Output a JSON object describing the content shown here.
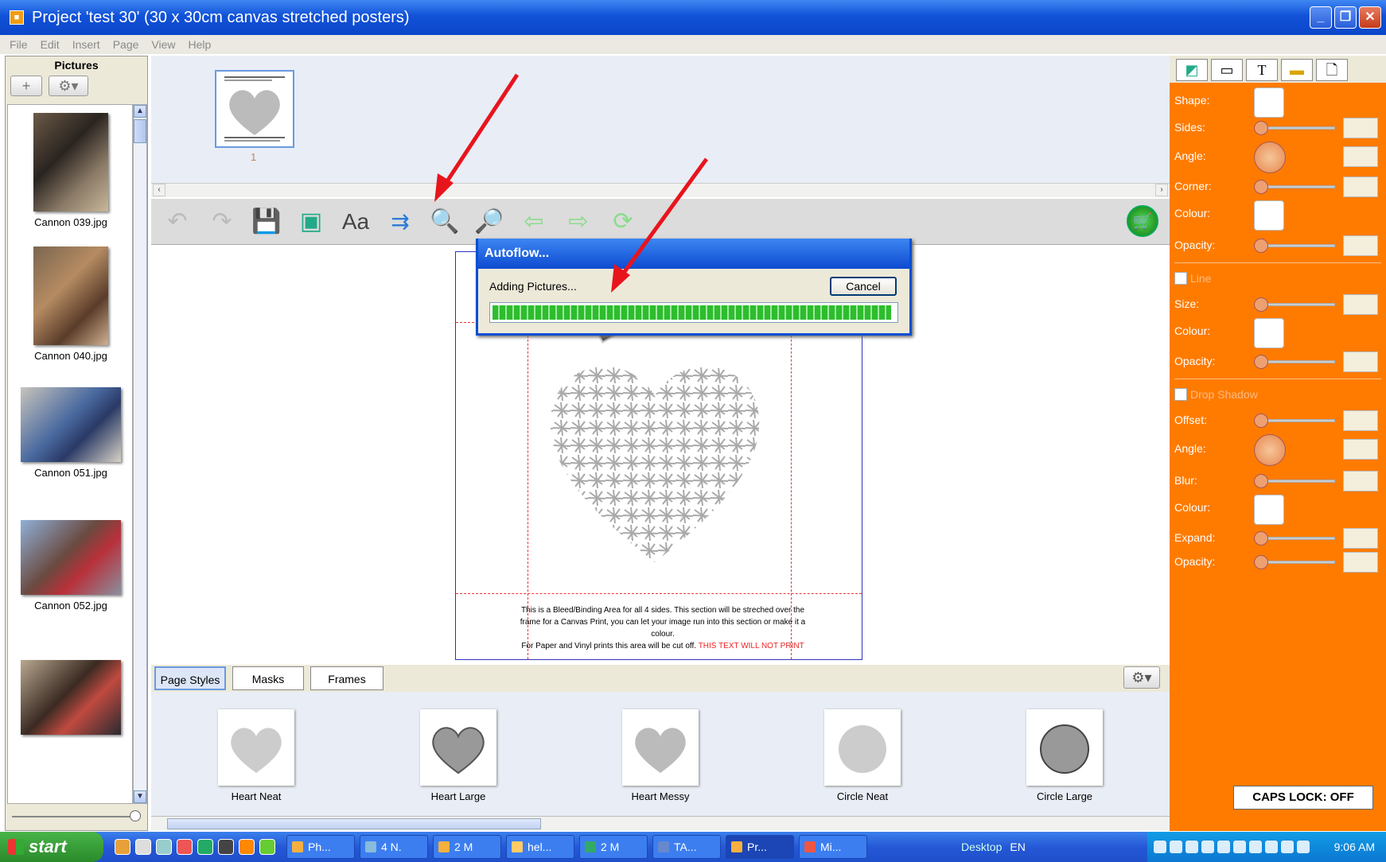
{
  "window": {
    "title": "Project 'test 30' (30 x 30cm canvas stretched posters)"
  },
  "menu": [
    "File",
    "Edit",
    "Insert",
    "Page",
    "View",
    "Help"
  ],
  "pictures_panel": {
    "title": "Pictures",
    "add_label": "+",
    "items": [
      {
        "name": "Cannon 039.jpg"
      },
      {
        "name": "Cannon 040.jpg"
      },
      {
        "name": "Cannon 051.jpg"
      },
      {
        "name": "Cannon 052.jpg"
      }
    ]
  },
  "pages": [
    {
      "number": "1"
    }
  ],
  "page_text": {
    "line1": "This is a Bleed/Binding Area for all 4 sides. This section will be streched over the",
    "line2": "frame for a Canvas Print, you can let your image run into this section or make it a",
    "line3": "colour.",
    "line4": "For Paper and Vinyl prints this area will be cut off.",
    "line4_red": "THIS TEXT WILL NOT PRINT"
  },
  "dialog": {
    "title": "Autoflow...",
    "message": "Adding Pictures...",
    "cancel": "Cancel",
    "progress": 0.99
  },
  "tabs": [
    {
      "label": "Page Styles",
      "selected": true
    },
    {
      "label": "Masks",
      "selected": false
    },
    {
      "label": "Frames",
      "selected": false
    }
  ],
  "styles": [
    {
      "label": "Heart Neat"
    },
    {
      "label": "Heart Large"
    },
    {
      "label": "Heart Messy"
    },
    {
      "label": "Circle Neat"
    },
    {
      "label": "Circle Large"
    }
  ],
  "right_panel": {
    "tab_text": "T",
    "shape": "Shape:",
    "sides": "Sides:",
    "angle": "Angle:",
    "corner": "Corner:",
    "colour": "Colour:",
    "opacity": "Opacity:",
    "line": "Line",
    "size": "Size:",
    "line_colour": "Colour:",
    "line_opacity": "Opacity:",
    "drop_shadow": "Drop Shadow",
    "offset": "Offset:",
    "shadow_angle": "Angle:",
    "blur": "Blur:",
    "shadow_colour": "Colour:",
    "expand": "Expand:",
    "shadow_opacity": "Opacity:",
    "caps_lock": "CAPS LOCK: OFF",
    "accent": "#ff7b00"
  },
  "taskbar": {
    "start": "start",
    "tasks": [
      "Ph...",
      "4 N.",
      "2 M",
      "hel...",
      "2 M",
      "TA...",
      "Pr...",
      "Mi..."
    ],
    "desktop": "Desktop",
    "lang": "EN",
    "clock": "9:06 AM"
  }
}
